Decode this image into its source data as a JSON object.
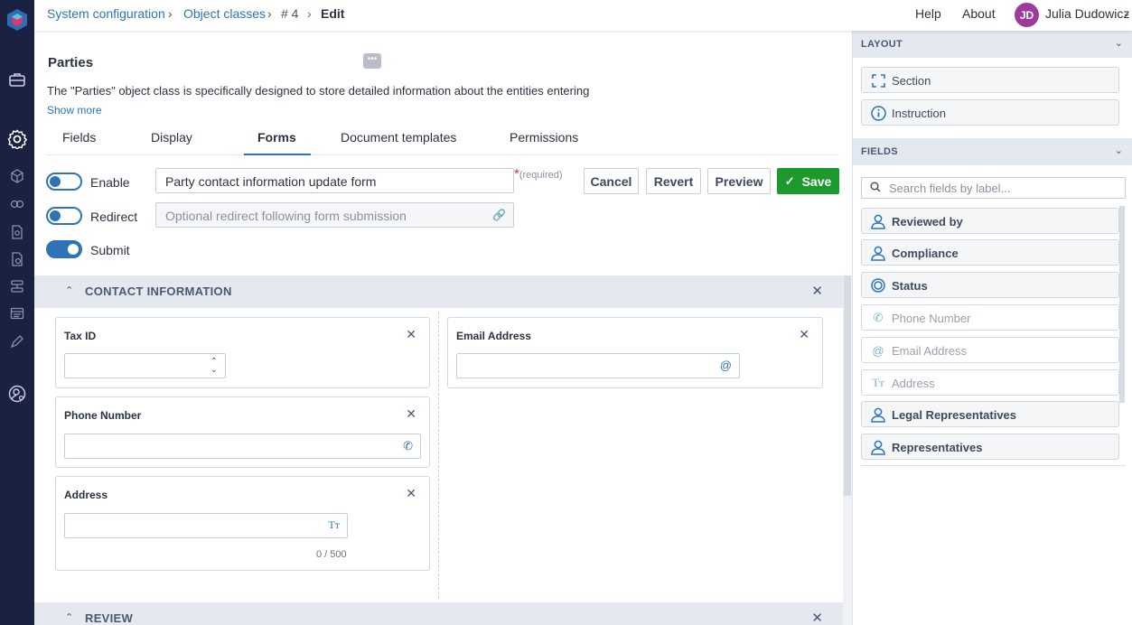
{
  "breadcrumb": {
    "items": [
      "System configuration",
      "Object classes",
      "# 4"
    ],
    "current": "Edit"
  },
  "header": {
    "help": "Help",
    "about": "About",
    "user_initials": "JD",
    "user_name": "Julia Dudowicz"
  },
  "object": {
    "title": "Parties",
    "description": "The \"Parties\" object class is specifically designed to store detailed information about the entities entering",
    "show_more": "Show more"
  },
  "tabs": [
    {
      "label": "Fields",
      "active": false
    },
    {
      "label": "Display",
      "active": false
    },
    {
      "label": "Forms",
      "active": true
    },
    {
      "label": "Document templates",
      "active": false
    },
    {
      "label": "Permissions",
      "active": false
    }
  ],
  "form": {
    "enable_label": "Enable",
    "enable_on": false,
    "redirect_label": "Redirect",
    "redirect_on": false,
    "submit_label": "Submit",
    "submit_on": true,
    "name_value": "Party contact information update form",
    "required_marker": "*",
    "required_text": "(required)",
    "redirect_placeholder": "Optional redirect following form submission"
  },
  "actions": {
    "cancel": "Cancel",
    "revert": "Revert",
    "preview": "Preview",
    "save": "Save"
  },
  "sections": [
    {
      "title": "CONTACT INFORMATION",
      "fields_left": [
        {
          "label": "Tax ID",
          "icon": "stepper-icon"
        },
        {
          "label": "Phone Number",
          "icon": "phone-icon"
        },
        {
          "label": "Address",
          "icon": "text-icon",
          "counter": "0 / 500"
        }
      ],
      "fields_right": [
        {
          "label": "Email Address",
          "icon": "at-icon"
        }
      ]
    },
    {
      "title": "REVIEW"
    }
  ],
  "layout_panel": {
    "title": "LAYOUT",
    "items": [
      {
        "label": "Section",
        "icon": "section-icon"
      },
      {
        "label": "Instruction",
        "icon": "info-icon"
      }
    ]
  },
  "fields_panel": {
    "title": "FIELDS",
    "search_placeholder": "Search fields by label...",
    "items": [
      {
        "label": "Reviewed by",
        "icon": "user-icon",
        "available": true
      },
      {
        "label": "Compliance",
        "icon": "user-icon",
        "available": true
      },
      {
        "label": "Status",
        "icon": "status-icon",
        "available": true
      },
      {
        "label": "Phone Number",
        "icon": "phone-icon",
        "available": false
      },
      {
        "label": "Email Address",
        "icon": "at-icon",
        "available": false
      },
      {
        "label": "Address",
        "icon": "text-icon",
        "available": false
      },
      {
        "label": "Legal Representatives",
        "icon": "user-icon",
        "available": true
      },
      {
        "label": "Representatives",
        "icon": "user-icon",
        "available": true
      }
    ]
  }
}
